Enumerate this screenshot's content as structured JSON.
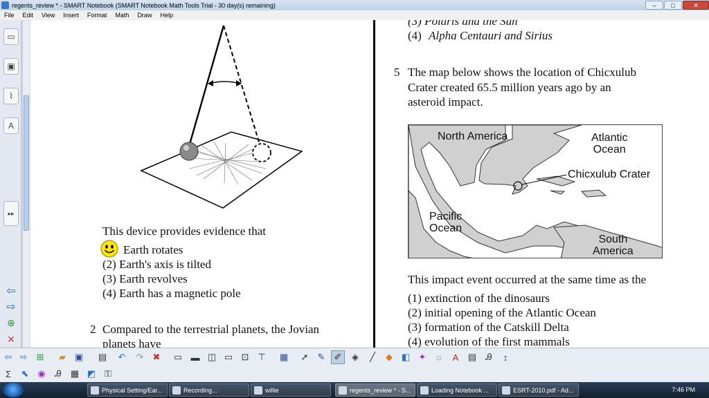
{
  "window": {
    "title": "regents_review * - SMART Notebook (SMART Notebook Math Tools Trial - 30 day(s) remaining)",
    "minimize_label": "–",
    "maximize_label": "□",
    "close_label": "✕"
  },
  "menu": [
    "File",
    "Edit",
    "View",
    "Insert",
    "Format",
    "Math",
    "Draw",
    "Help"
  ],
  "left_panel": {
    "tabs": [
      "page-sorter-icon",
      "gallery-icon",
      "attachments-icon",
      "properties-icon"
    ],
    "nav": [
      "back-icon",
      "forward-icon",
      "add-page-icon",
      "delete-page-icon"
    ],
    "expand_label": "▸▸"
  },
  "page": {
    "q1_prompt": "This device provides evidence that",
    "q1_options": [
      "Earth rotates",
      "(2)  Earth's axis is tilted",
      "(3)  Earth revolves",
      "(4)  Earth has a magnetic pole"
    ],
    "q2_number": "2",
    "q2_line1": "Compared to the terrestrial planets, the Jovian",
    "q2_line2": "planets have",
    "q4_option3_partial": "(3)  Polaris and the Sun",
    "q4_option4_num": "(4)",
    "q4_option4_text": "Alpha Centauri and Sirius",
    "q5_number": "5",
    "q5_line1": "The map below shows the location of Chicxulub",
    "q5_line2": "Crater created 65.5 million years ago by an",
    "q5_line3": "asteroid impact.",
    "map_labels": {
      "north_america": "North America",
      "atlantic": "Atlantic\nOcean",
      "chicxulub": "Chicxulub Crater",
      "pacific": "Pacific\nOcean",
      "south_america": "South\nAmerica"
    },
    "q5_prompt": "This impact event occurred at the same time as the",
    "q5_options": [
      "(1)  extinction of the dinosaurs",
      "(2)  initial opening of the Atlantic Ocean",
      "(3)  formation of the Catskill Delta",
      "(4)  evolution of the first mammals"
    ]
  },
  "toolbar_row1": [
    "previous-page-icon",
    "next-page-icon",
    "add-page-icon",
    "open-file-icon",
    "save-icon",
    "paste-icon",
    "undo-icon",
    "redo-icon",
    "delete-icon",
    "screen-shade-icon",
    "full-screen-icon",
    "dual-page-icon",
    "display-icon",
    "capture-icon",
    "doc-camera-icon",
    "table-icon",
    "select-icon",
    "pen-icon",
    "creative-pen-icon",
    "eraser-icon",
    "line-icon",
    "shape-icon",
    "fill-icon",
    "magic-pen-icon",
    "shape-recognition-icon",
    "text-icon",
    "properties-icon",
    "font-icon",
    "move-toolbar-icon"
  ],
  "toolbar_row2": [
    "sigma-icon",
    "math-icon",
    "eraser-tool-icon",
    "handwriting-icon",
    "table-tool-icon",
    "graph-icon",
    "measure-icon"
  ],
  "taskbar": {
    "tasks": [
      "Physical Setting/Ear...",
      "Recording...",
      "willie",
      "regents_review * - S...",
      "Loading Notebook ...",
      "ESRT-2010.pdf - Ad..."
    ],
    "active_index": 3,
    "clock": "7:46 PM"
  }
}
